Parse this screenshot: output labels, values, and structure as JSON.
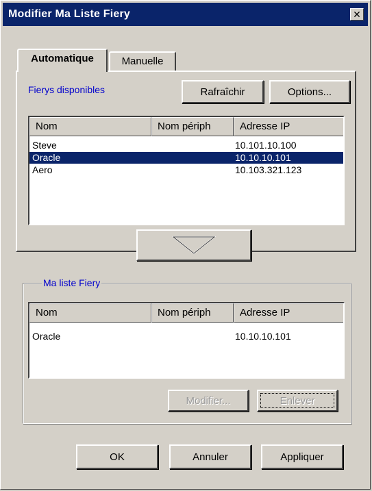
{
  "window": {
    "title": "Modifier Ma Liste Fiery",
    "close_glyph": "✕"
  },
  "tabs": [
    {
      "label": "Automatique",
      "active": true
    },
    {
      "label": "Manuelle",
      "active": false
    }
  ],
  "automatic": {
    "section_label": "Fierys disponibles",
    "refresh_label": "Rafraîchir",
    "options_label": "Options...",
    "columns": [
      "Nom",
      "Nom périph",
      "Adresse IP"
    ],
    "rows": [
      {
        "name": "Steve",
        "device": "",
        "ip": "10.101.10.100",
        "selected": false
      },
      {
        "name": "Oracle",
        "device": "",
        "ip": "10.10.10.101",
        "selected": true
      },
      {
        "name": "Aero",
        "device": "",
        "ip": "10.103.321.123",
        "selected": false
      }
    ],
    "add_button_icon": "down-triangle-icon"
  },
  "my_list": {
    "group_label": "Ma liste Fiery",
    "columns": [
      "Nom",
      "Nom périph",
      "Adresse IP"
    ],
    "rows": [
      {
        "name": "Oracle",
        "device": "",
        "ip": "10.10.10.101",
        "selected": false
      }
    ],
    "modify_label": "Modifier...",
    "remove_label": "Enlever"
  },
  "footer": {
    "ok_label": "OK",
    "cancel_label": "Annuler",
    "apply_label": "Appliquer"
  },
  "colors": {
    "face": "#d4d0c8",
    "title_bg": "#0a246a",
    "label_blue": "#0000cc",
    "selection": "#0a246a"
  }
}
